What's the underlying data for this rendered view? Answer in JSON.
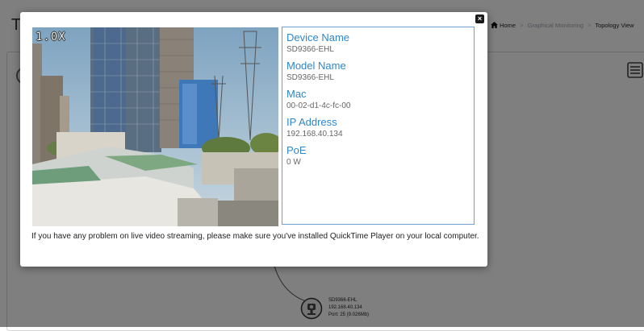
{
  "page": {
    "title": "To",
    "breadcrumb": [
      "Home",
      "Graphical Monitoring",
      "Topology View"
    ]
  },
  "topology_node": {
    "name": "SD9366-EHL",
    "ip": "192.168.40.134",
    "port": "Port: 25 (9.026Mb)"
  },
  "modal": {
    "close_label": "×",
    "video": {
      "zoom": "1.0X"
    },
    "device": [
      {
        "label": "Device Name",
        "value": "SD9366-EHL"
      },
      {
        "label": "Model Name",
        "value": "SD9366-EHL"
      },
      {
        "label": "Mac",
        "value": "00-02-d1-4c-fc-00"
      },
      {
        "label": "IP Address",
        "value": "192.168.40.134"
      },
      {
        "label": "PoE",
        "value": "0 W"
      }
    ],
    "notice": "If you have any problem on live video streaming, please make sure you've installed QuickTime Player on your local computer."
  },
  "colors": {
    "accent": "#2f86c9",
    "info_border": "#6f9fd1",
    "overlay": "#000000"
  }
}
